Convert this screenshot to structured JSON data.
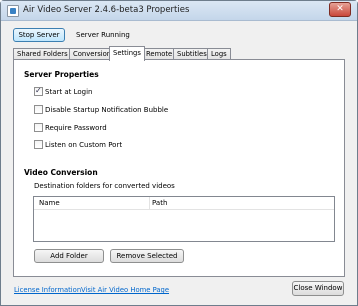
{
  "window": {
    "title": "Air Video Server 2.4.6-beta3 Properties",
    "close_glyph": "✕"
  },
  "server": {
    "stop_label": "Stop Server",
    "status": "Server Running"
  },
  "tabs": [
    {
      "label": "Shared Folders",
      "active": false
    },
    {
      "label": "Conversion",
      "active": false
    },
    {
      "label": "Settings",
      "active": true
    },
    {
      "label": "Remote",
      "active": false
    },
    {
      "label": "Subtitles",
      "active": false
    },
    {
      "label": "Logs",
      "active": false
    }
  ],
  "server_properties": {
    "heading": "Server Properties",
    "options": [
      {
        "label": "Start at Login",
        "checked": true
      },
      {
        "label": "Disable Startup Notification Bubble",
        "checked": false
      },
      {
        "label": "Require Password",
        "checked": false
      },
      {
        "label": "Listen on Custom Port",
        "checked": false
      }
    ]
  },
  "video_conversion": {
    "heading": "Video Conversion",
    "description": "Destination folders for converted videos",
    "columns": [
      "Name",
      "Path"
    ],
    "add_label": "Add Folder",
    "remove_label": "Remove Selected"
  },
  "footer": {
    "license_link": "License Information",
    "home_link": "Visit Air Video Home Page",
    "close_label": "Close Window"
  },
  "colors": {
    "link": "#0066cc",
    "close_button": "#c9463a",
    "default_button_border": "#3c7fb1"
  }
}
